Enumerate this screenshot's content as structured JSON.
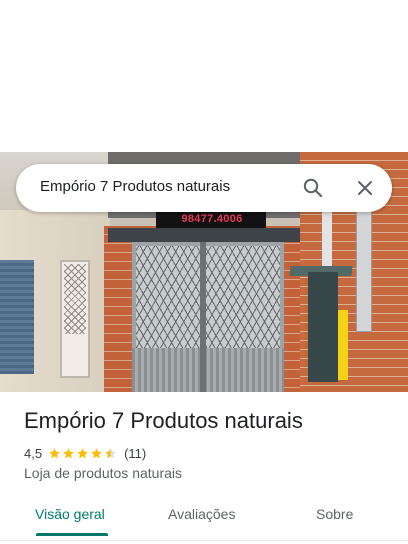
{
  "search": {
    "query": "Empório 7 Produtos naturais"
  },
  "photo": {
    "sign_phone": "98477.4006"
  },
  "place": {
    "title": "Empório 7 Produtos naturais",
    "rating": "4,5",
    "rating_stars": 4.5,
    "review_count": "(11)",
    "category": "Loja de produtos naturais"
  },
  "tabs": [
    {
      "label": "Visão geral",
      "active": true
    },
    {
      "label": "Avaliações",
      "active": false
    },
    {
      "label": "Sobre",
      "active": false
    }
  ],
  "colors": {
    "accent": "#00796b",
    "star": "#fbbc04"
  }
}
